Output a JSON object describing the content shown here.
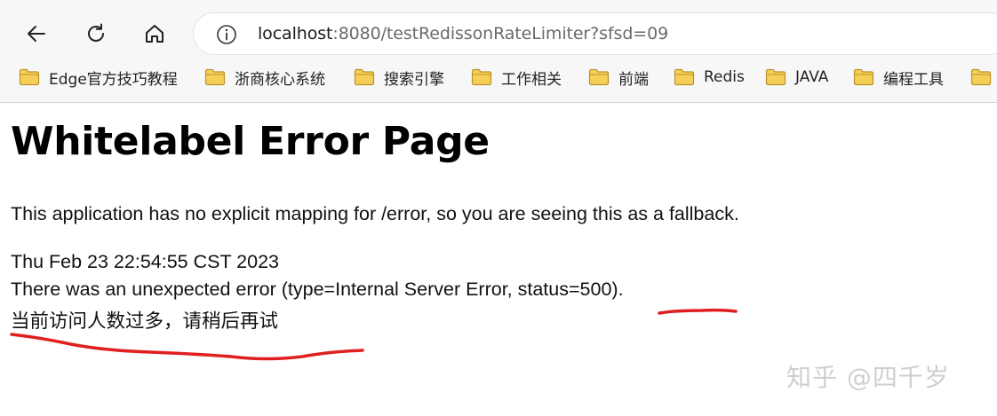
{
  "browser": {
    "address": {
      "host": "localhost",
      "rest": ":8080/testRedissonRateLimiter?sfsd=09"
    },
    "bookmarks": [
      {
        "label": "Edge官方技巧教程"
      },
      {
        "label": "浙商核心系统"
      },
      {
        "label": "搜索引擎"
      },
      {
        "label": "工作相关"
      },
      {
        "label": "前端"
      },
      {
        "label": "Redis"
      },
      {
        "label": "JAVA"
      },
      {
        "label": "编程工具"
      }
    ],
    "icons": {
      "back": "back-arrow-icon",
      "reload": "reload-icon",
      "home": "home-icon",
      "info": "info-icon",
      "folder": "folder-icon"
    },
    "folder_color": "#f4c542"
  },
  "page": {
    "title": "Whitelabel Error Page",
    "message": "This application has no explicit mapping for /error, so you are seeing this as a fallback.",
    "timestamp": "Thu Feb 23 22:54:55 CST 2023",
    "error": "There was an unexpected error (type=Internal Server Error, status=500).",
    "custom_message": "当前访问人数过多，请稍后再试"
  },
  "watermark": "知乎 @四千岁",
  "annotation_color": "#e02020"
}
